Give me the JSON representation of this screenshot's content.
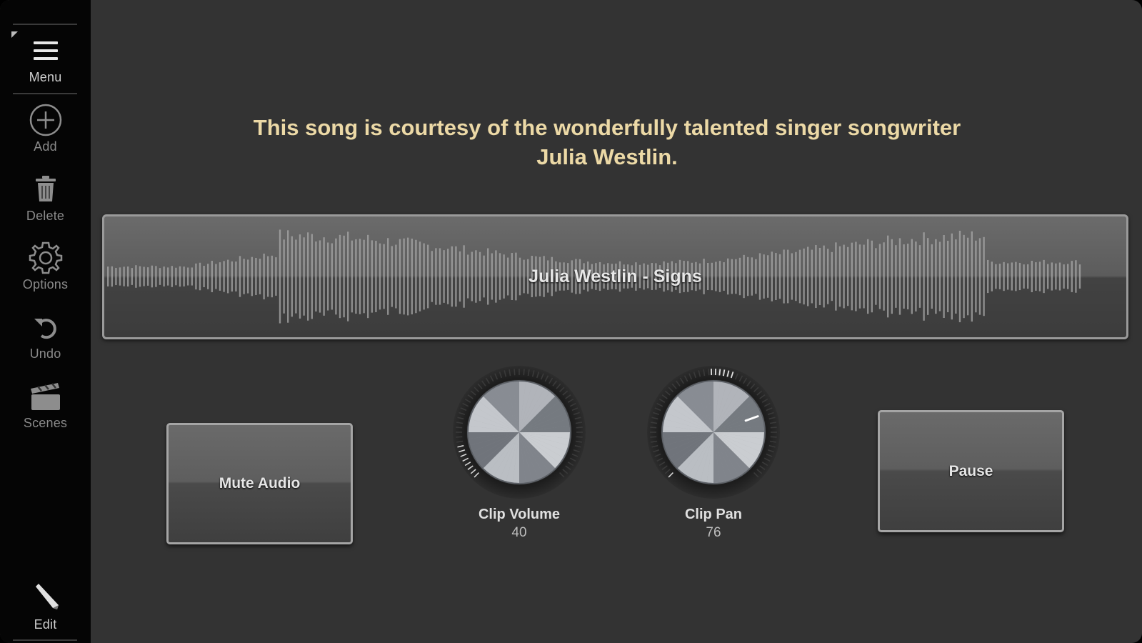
{
  "sidebar": {
    "items": [
      {
        "label": "Menu",
        "icon": "menu-icon"
      },
      {
        "label": "Add",
        "icon": "plus-circle-icon"
      },
      {
        "label": "Delete",
        "icon": "trash-icon"
      },
      {
        "label": "Options",
        "icon": "gear-icon"
      },
      {
        "label": "Undo",
        "icon": "undo-icon"
      },
      {
        "label": "Scenes",
        "icon": "clapperboard-icon"
      },
      {
        "label": "Edit",
        "icon": "pencil-icon"
      }
    ]
  },
  "main": {
    "credit_line1": "This song is courtesy of the wonderfully talented singer songwriter",
    "credit_line2": "Julia Westlin.",
    "clip": {
      "title": "Julia Westlin - Signs"
    },
    "mute_button": "Mute Audio",
    "pause_button": "Pause",
    "knobs": [
      {
        "label": "Clip Volume",
        "value": "40",
        "level": 0.4
      },
      {
        "label": "Clip Pan",
        "value": "76",
        "level": 0.76
      }
    ]
  },
  "colors": {
    "background": "#333333",
    "sidebar": "#050505",
    "credit_text": "#ecd9a6"
  }
}
